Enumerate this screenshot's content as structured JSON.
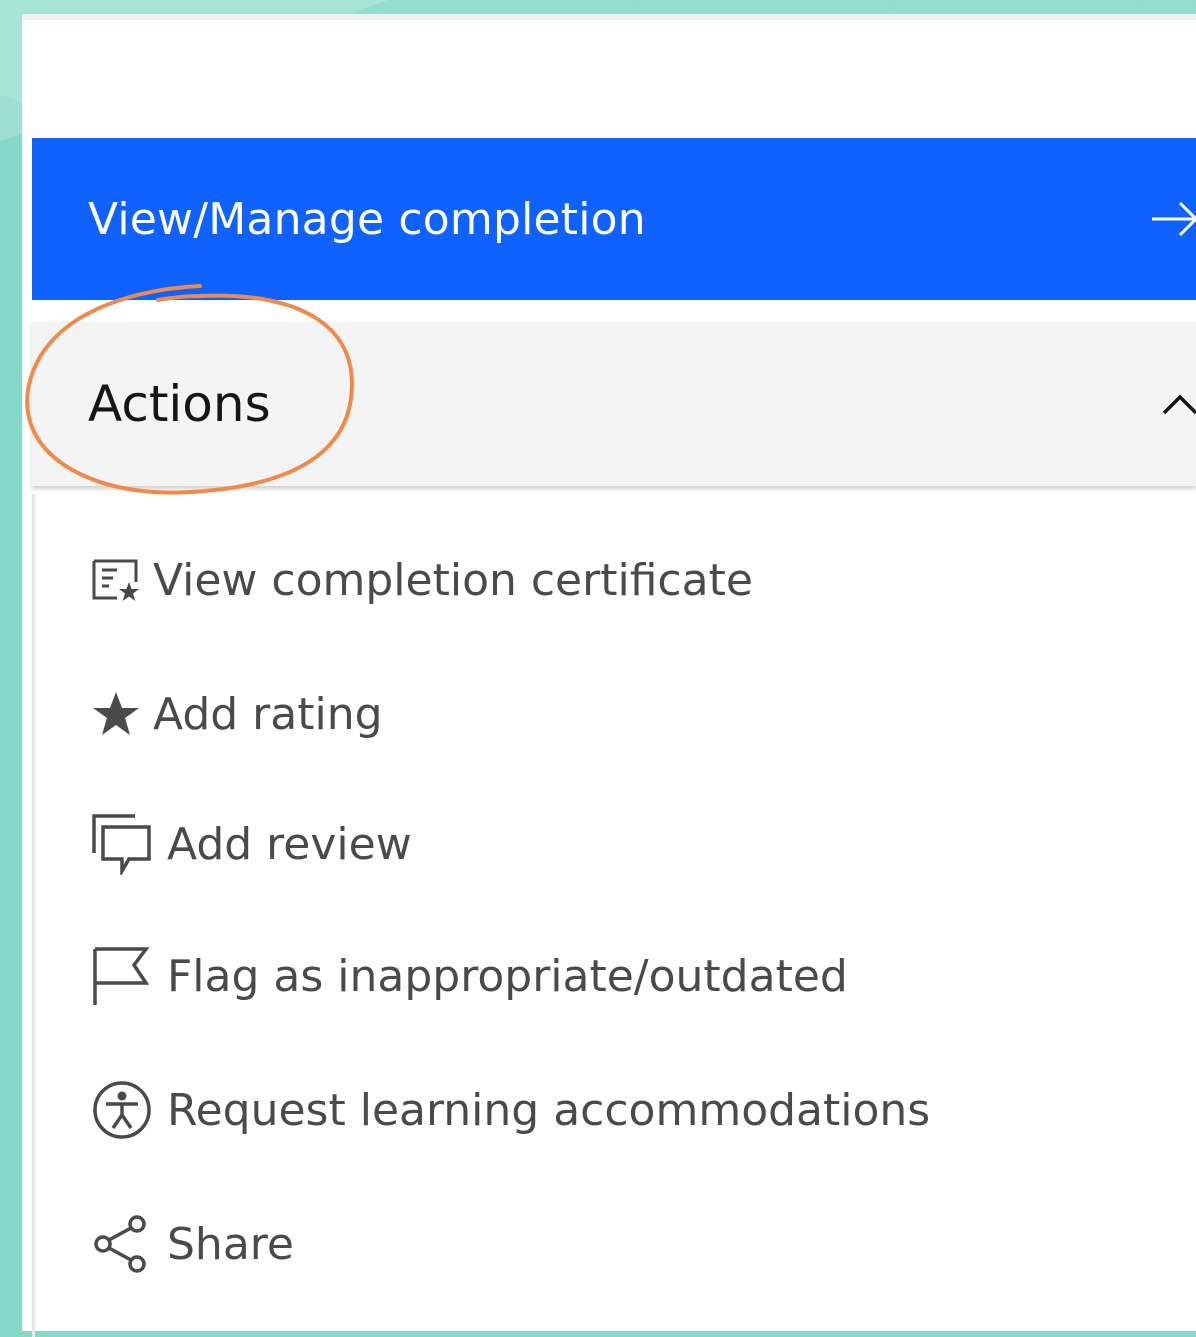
{
  "primary_action": {
    "label": "View/Manage completion"
  },
  "actions": {
    "title": "Actions",
    "items": [
      {
        "label": "View completion certificate",
        "icon": "certificate-icon"
      },
      {
        "label": "Add rating",
        "icon": "star-icon"
      },
      {
        "label": "Add review",
        "icon": "chat-bubble-icon"
      },
      {
        "label": "Flag as inappropriate/outdated",
        "icon": "flag-icon"
      },
      {
        "label": "Request learning accommodations",
        "icon": "accessibility-icon"
      },
      {
        "label": "Share",
        "icon": "share-icon"
      }
    ]
  },
  "colors": {
    "primary": "#0f62fe",
    "annotation": "#f08a4b",
    "background": "#86d8c8"
  }
}
